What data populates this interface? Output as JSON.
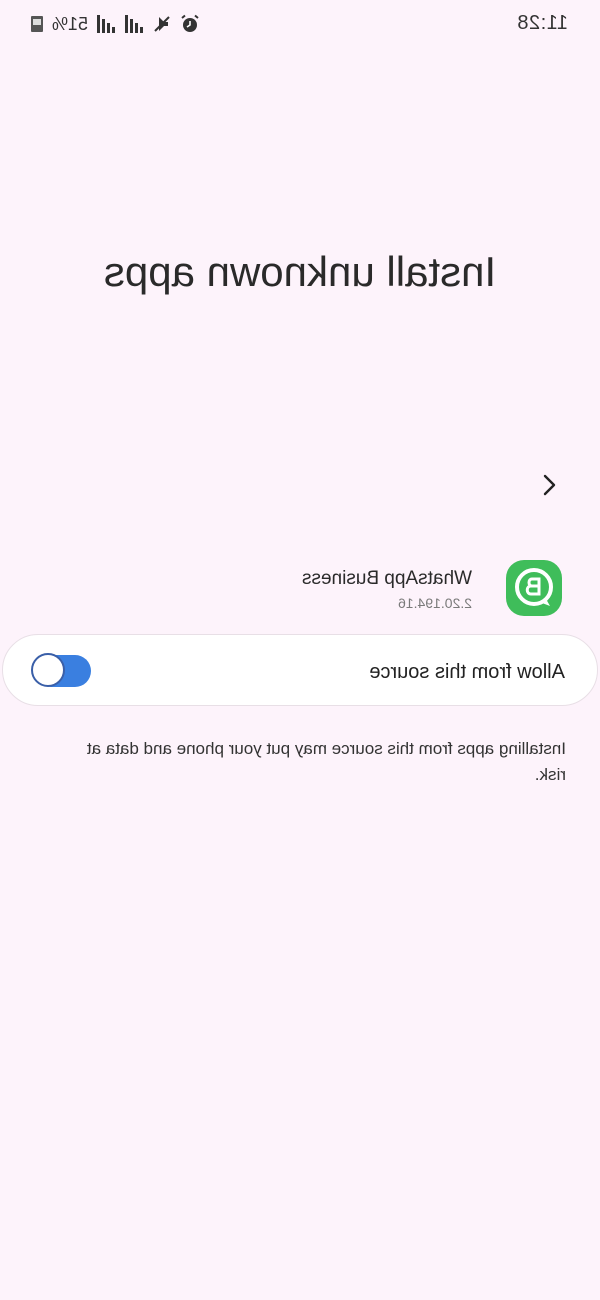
{
  "status_bar": {
    "time": "11:28",
    "battery": "51%",
    "icons": [
      "image-icon",
      "signal-icon",
      "signal-icon",
      "mute-icon",
      "alarm-icon"
    ]
  },
  "page": {
    "title": "Install unknown apps"
  },
  "app": {
    "name": "WhatsApp Business",
    "version": "2.20.194.16",
    "icon": "whatsapp-business-icon",
    "icon_color": "#3fbd5a"
  },
  "allow": {
    "label": "Allow from this source",
    "enabled": true,
    "toggle_color": "#3a7fe0"
  },
  "description": "Installing apps from this source may put your phone and data at risk."
}
